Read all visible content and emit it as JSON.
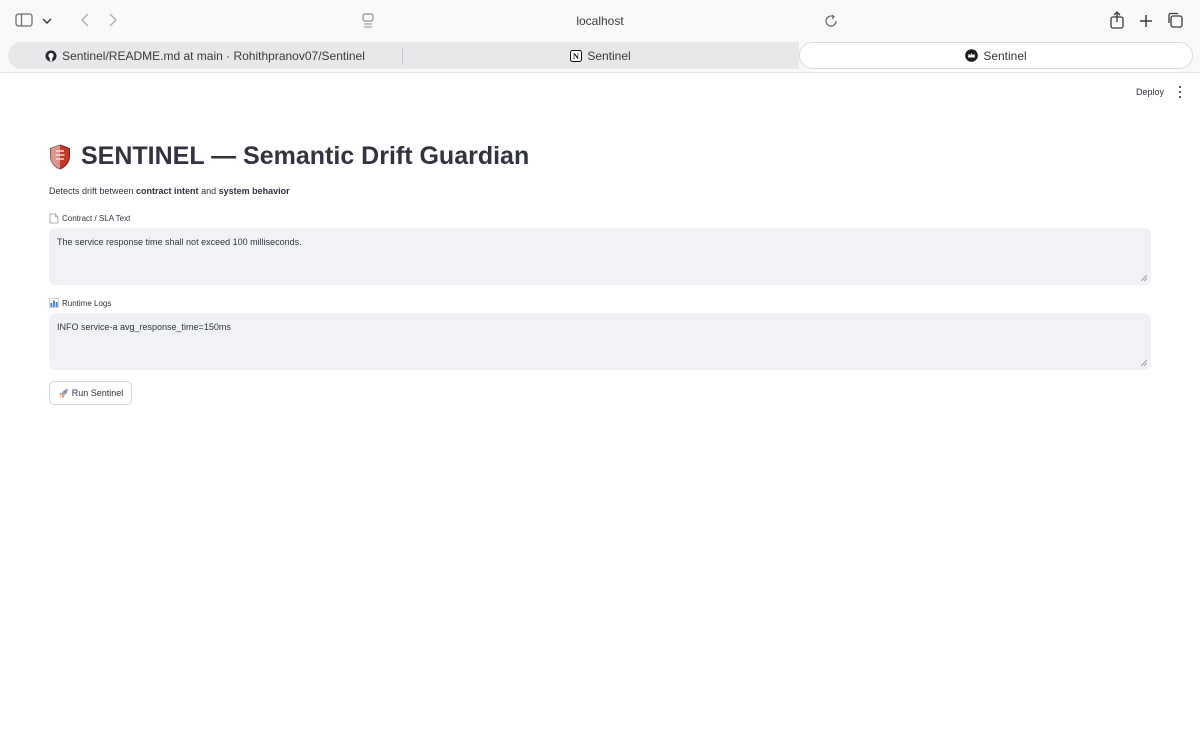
{
  "browser": {
    "address": "localhost",
    "tabs": [
      {
        "label": "Sentinel/README.md at main · Rohithpranov07/Sentinel",
        "icon": "github-icon"
      },
      {
        "label": "Sentinel",
        "icon": "notion-icon"
      },
      {
        "label": "Sentinel",
        "icon": "streamlit-crown-icon"
      }
    ]
  },
  "app": {
    "deploy_label": "Deploy",
    "title": "SENTINEL — Semantic Drift Guardian",
    "caption": {
      "prefix": "Detects drift between ",
      "bold1": "contract intent",
      "middle": " and ",
      "bold2": "system behavior"
    },
    "contract": {
      "label": "Contract / SLA Text",
      "value": "The service response time shall not exceed 100 milliseconds."
    },
    "logs": {
      "label": "Runtime Logs",
      "value": "INFO service-a avg_response_time=150ms"
    },
    "run_button": "Run Sentinel"
  },
  "colors": {
    "input_bg": "#f0f2f6",
    "text": "#31333f",
    "shield_red": "#d9534f"
  }
}
